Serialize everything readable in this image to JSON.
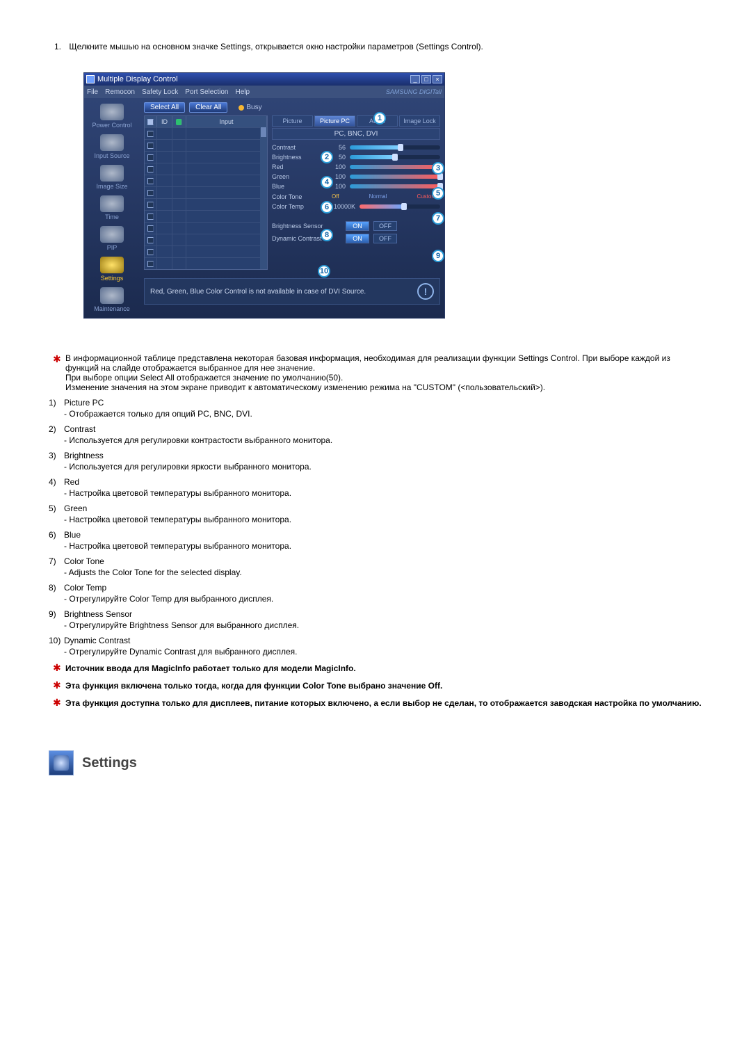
{
  "intro": {
    "number": "1.",
    "text": "Щелкните мышью на основном значке Settings, открывается окно настройки параметров (Settings Control)."
  },
  "window": {
    "title": "Multiple Display Control",
    "brand": "SAMSUNG DIGITall",
    "menu": {
      "file": "File",
      "remocon": "Remocon",
      "safety_lock": "Safety Lock",
      "port": "Port Selection",
      "help": "Help"
    },
    "sidebar": [
      {
        "label": "Power Control"
      },
      {
        "label": "Input Source"
      },
      {
        "label": "Image Size"
      },
      {
        "label": "Time"
      },
      {
        "label": "PIP"
      },
      {
        "label": "Settings",
        "active": true
      },
      {
        "label": "Maintenance"
      }
    ],
    "buttons": {
      "select_all": "Select All",
      "clear_all": "Clear All",
      "busy": "Busy"
    },
    "grid_headers": {
      "id": "ID",
      "input": "Input"
    },
    "tabs": {
      "picture": "Picture",
      "picture_pc": "Picture PC",
      "audio": "Audio",
      "image_lock": "Image Lock"
    },
    "source_label": "PC, BNC, DVI",
    "settings": {
      "contrast": {
        "label": "Contrast",
        "value": "56"
      },
      "brightness": {
        "label": "Brightness",
        "value": "50"
      },
      "red": {
        "label": "Red",
        "value": "100"
      },
      "green": {
        "label": "Green",
        "value": "100"
      },
      "blue": {
        "label": "Blue",
        "value": "100"
      },
      "color_tone": {
        "label": "Color Tone",
        "off": "Off",
        "normal": "Normal",
        "custom": "Custom"
      },
      "color_temp": {
        "label": "Color Temp",
        "value": "10000K"
      },
      "brightness_sensor": {
        "label": "Brightness Sensor",
        "on": "ON",
        "off": "OFF"
      },
      "dynamic_contrast": {
        "label": "Dynamic Contrast",
        "on": "ON",
        "off": "OFF"
      }
    },
    "footer_note": "Red, Green, Blue Color Control is not available in case of DVI Source.",
    "callout_labels": {
      "1": "1",
      "2": "2",
      "3": "3",
      "4": "4",
      "5": "5",
      "6": "6",
      "7": "7",
      "8": "8",
      "9": "9",
      "10": "10"
    }
  },
  "main_note": {
    "p1": "В информационной таблице представлена некоторая базовая информация, необходимая для реализации функции Settings Control. При выборе каждой из функций на слайде отображается выбранное для нее значение.",
    "p2": "При выборе опции Select All отображается значение по умолчанию(50).",
    "p3": "Изменение значения на этом экране приводит к автоматическому изменению режима на \"CUSTOM\" (<пользовательский>)."
  },
  "items": [
    {
      "n": "1)",
      "title": "Picture PC",
      "desc": "- Отображается только для опций PC, BNC, DVI."
    },
    {
      "n": "2)",
      "title": "Contrast",
      "desc": "- Используется для регулировки контрастости выбранного монитора."
    },
    {
      "n": "3)",
      "title": "Brightness",
      "desc": "- Используется для регулировки яркости выбранного монитора."
    },
    {
      "n": "4)",
      "title": "Red",
      "desc": "- Настройка цветовой температуры выбранного монитора."
    },
    {
      "n": "5)",
      "title": "Green",
      "desc": "- Настройка цветовой температуры выбранного монитора."
    },
    {
      "n": "6)",
      "title": "Blue",
      "desc": "- Настройка цветовой температуры выбранного монитора."
    },
    {
      "n": "7)",
      "title": "Color Tone",
      "desc": "- Adjusts the Color Tone for the selected display."
    },
    {
      "n": "8)",
      "title": "Color Temp",
      "desc": "- Отрегулируйте Color Temp для выбранного дисплея."
    },
    {
      "n": "9)",
      "title": "Brightness Sensor",
      "desc": "- Отрегулируйте Brightness Sensor для выбранного дисплея."
    },
    {
      "n": "10)",
      "title": "Dynamic Contrast",
      "desc": "- Отрегулируйте Dynamic Contrast для выбранного дисплея."
    }
  ],
  "footnotes": [
    "Источник ввода для MagicInfo работает только для модели MagicInfo.",
    "Эта функция включена только тогда, когда для функции Color Tone выбрано значение Off.",
    "Эта функция доступна только для дисплеев, питание которых включено, а если выбор не сделан, то отображается заводская настройка по умолчанию."
  ],
  "section_heading": "Settings"
}
